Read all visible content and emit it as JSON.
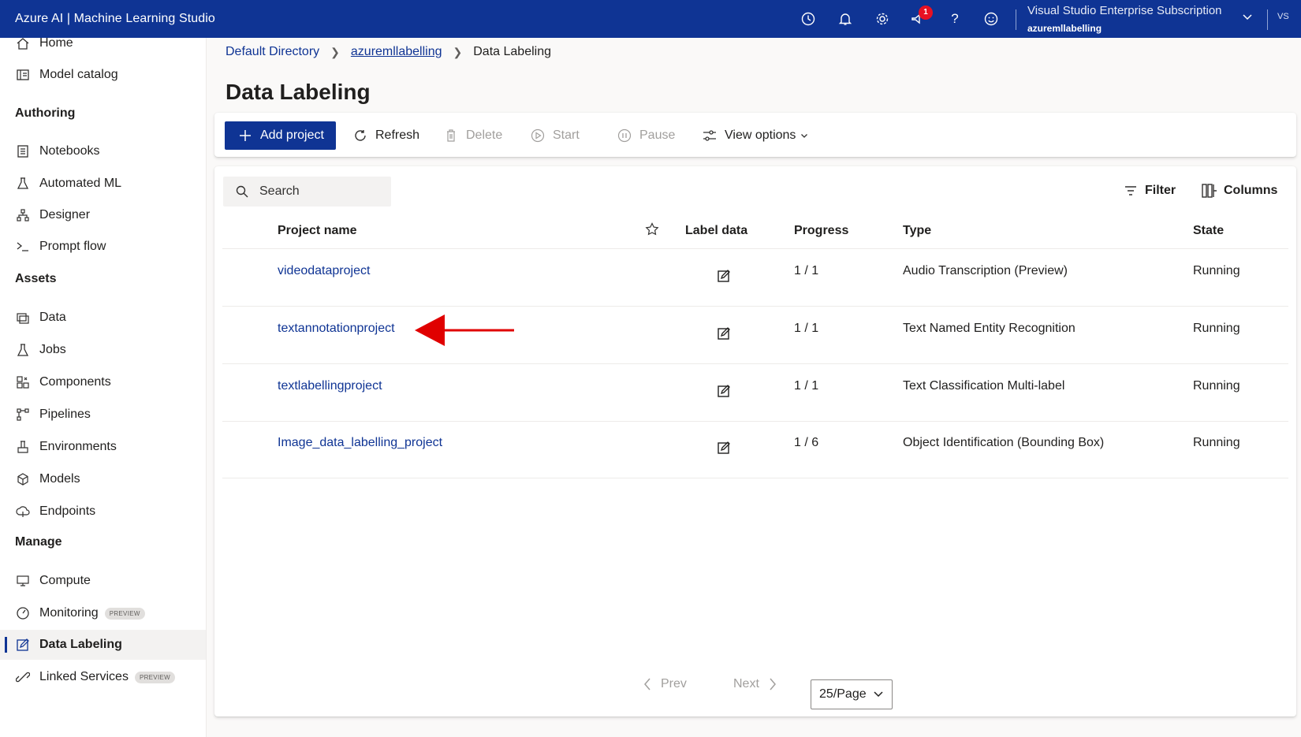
{
  "app_title": "Azure AI | Machine Learning Studio",
  "topbar": {
    "notification_count": "1",
    "subscription_name": "Visual Studio Enterprise Subscription",
    "workspace_name": "azuremllabelling",
    "avatar_initials": "VS",
    "icons": [
      "history-icon",
      "bell-icon",
      "gear-icon",
      "feedback-icon",
      "help-icon",
      "smiley-icon"
    ]
  },
  "sidebar": {
    "top_items": [
      {
        "label": "Home",
        "icon": "home-icon"
      },
      {
        "label": "Model catalog",
        "icon": "catalog-icon"
      }
    ],
    "sections": [
      {
        "heading": "Authoring",
        "items": [
          {
            "label": "Notebooks",
            "icon": "notebook-icon"
          },
          {
            "label": "Automated ML",
            "icon": "automl-icon"
          },
          {
            "label": "Designer",
            "icon": "designer-icon"
          },
          {
            "label": "Prompt flow",
            "icon": "prompt-flow-icon"
          }
        ]
      },
      {
        "heading": "Assets",
        "items": [
          {
            "label": "Data",
            "icon": "data-icon"
          },
          {
            "label": "Jobs",
            "icon": "jobs-icon"
          },
          {
            "label": "Components",
            "icon": "components-icon"
          },
          {
            "label": "Pipelines",
            "icon": "pipelines-icon"
          },
          {
            "label": "Environments",
            "icon": "environments-icon"
          },
          {
            "label": "Models",
            "icon": "models-icon"
          },
          {
            "label": "Endpoints",
            "icon": "endpoints-icon"
          }
        ]
      },
      {
        "heading": "Manage",
        "items": [
          {
            "label": "Compute",
            "icon": "compute-icon"
          },
          {
            "label": "Monitoring",
            "icon": "monitoring-icon",
            "badge": "PREVIEW"
          },
          {
            "label": "Data Labeling",
            "icon": "data-labeling-icon",
            "active": true
          },
          {
            "label": "Linked Services",
            "icon": "linked-services-icon",
            "badge": "PREVIEW"
          }
        ]
      }
    ]
  },
  "breadcrumb": [
    "Default Directory",
    "azuremllabelling",
    "Data Labeling"
  ],
  "page_title": "Data Labeling",
  "toolbar": {
    "add_project": "Add project",
    "refresh": "Refresh",
    "delete": "Delete",
    "start": "Start",
    "pause": "Pause",
    "view_options": "View options"
  },
  "panel": {
    "search_placeholder": "Search",
    "filter": "Filter",
    "columns": "Columns"
  },
  "table": {
    "headers": {
      "project_name": "Project name",
      "label_data": "Label data",
      "progress": "Progress",
      "type": "Type",
      "state": "State"
    },
    "rows": [
      {
        "name": "videodataproject",
        "progress": "1 / 1",
        "type": "Audio Transcription (Preview)",
        "state": "Running"
      },
      {
        "name": "textannotationproject",
        "progress": "1 / 1",
        "type": "Text Named Entity Recognition",
        "state": "Running"
      },
      {
        "name": "textlabellingproject",
        "progress": "1 / 1",
        "type": "Text Classification Multi-label",
        "state": "Running"
      },
      {
        "name": "Image_data_labelling_project",
        "progress": "1 / 6",
        "type": "Object Identification (Bounding Box)",
        "state": "Running"
      }
    ]
  },
  "pagination": {
    "prev": "Prev",
    "next": "Next",
    "page_size": "25/Page"
  },
  "colors": {
    "brand": "#0f3494",
    "arrow": "#e00000",
    "badge": "#e81123"
  }
}
